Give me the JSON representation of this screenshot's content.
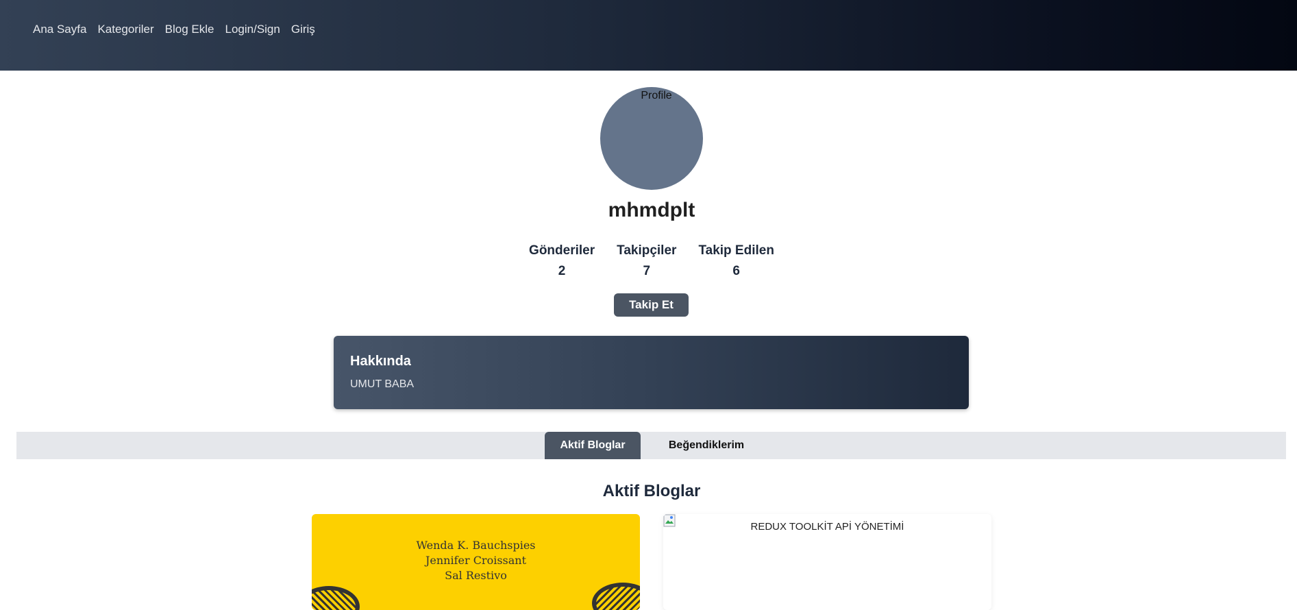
{
  "nav": {
    "links": [
      "Ana Sayfa",
      "Kategoriler",
      "Blog Ekle",
      "Login/Sign",
      "Giriş"
    ]
  },
  "profile": {
    "avatar_alt": "Profile",
    "username": "mhmdplt",
    "stats": [
      {
        "label": "Gönderiler",
        "value": "2"
      },
      {
        "label": "Takipçiler",
        "value": "7"
      },
      {
        "label": "Takip Edilen",
        "value": "6"
      }
    ],
    "follow_label": "Takip Et"
  },
  "about": {
    "title": "Hakkında",
    "text": "UMUT BABA"
  },
  "tabs": [
    {
      "label": "Aktif Bloglar",
      "active": true
    },
    {
      "label": "Beğendiklerim",
      "active": false
    }
  ],
  "section": {
    "title": "Aktif Bloglar"
  },
  "blogs": [
    {
      "cover_authors": [
        "Wenda K. Bauchspies",
        "Jennifer Croissant",
        "Sal Restivo"
      ]
    },
    {
      "image_alt": "REDUX TOOLKİT APİ YÖNETİMİ"
    }
  ],
  "colors": {
    "nav_gradient_start": "#334155",
    "nav_gradient_end": "#030712",
    "avatar_bg": "#64748b",
    "button_bg": "#4b5563",
    "tabs_bar_bg": "#e5e7eb",
    "book_cover_yellow": "#fdd000"
  }
}
